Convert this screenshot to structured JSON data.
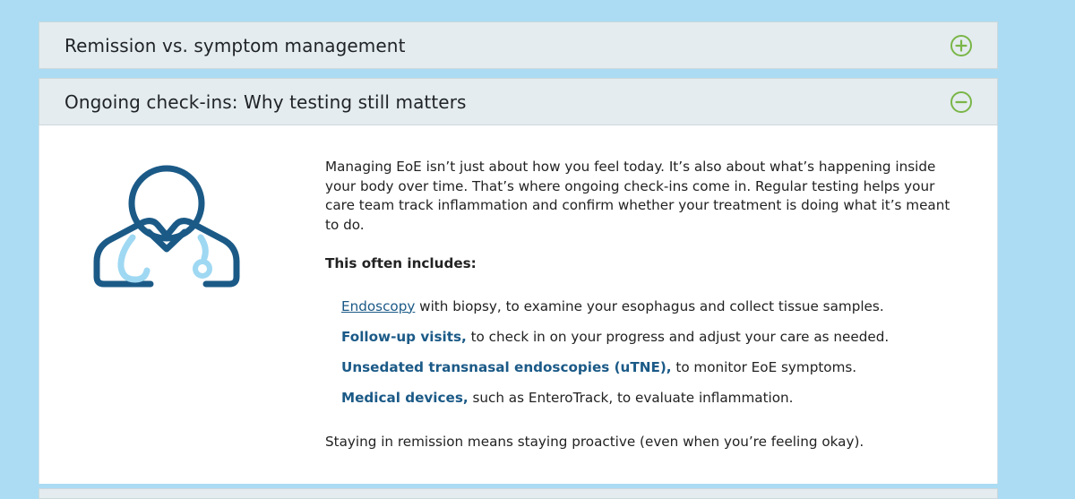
{
  "accordion": {
    "items": [
      {
        "title": "Remission vs. symptom management",
        "state_icon": "plus-circle-icon",
        "expanded": false
      },
      {
        "title": "Ongoing check-ins: Why testing still matters",
        "state_icon": "minus-circle-icon",
        "expanded": true
      }
    ]
  },
  "content": {
    "illustration_icon": "doctor-with-stethoscope-icon",
    "intro": "Managing EoE isn’t just about how you feel today. It’s also about what’s happening inside your body over time. That’s where ongoing check-ins come in. Regular testing helps your care team track inflammation and confirm whether your treatment is doing what it’s meant to do.",
    "includes_heading": "This often includes:",
    "list": [
      {
        "term": "Endoscopy",
        "text": " with biopsy, to examine your esophagus and collect tissue samples.",
        "is_link": true
      },
      {
        "term": "Follow-up visits,",
        "text": " to check in on your progress and adjust your care as needed.",
        "is_link": false
      },
      {
        "term": "Unsedated transnasal endoscopies (uTNE),",
        "text": " to monitor EoE symptoms.",
        "is_link": false
      },
      {
        "term": "Medical devices,",
        "text": " such as EnteroTrack, to evaluate inflammation.",
        "is_link": false
      }
    ],
    "closing": "Staying in remission means staying proactive (even when you’re feeling okay)."
  },
  "colors": {
    "page_background": "#abdcf4",
    "header_background": "#e4ecef",
    "toggle_green": "#7ab648",
    "icon_navy": "#1b5a87",
    "icon_light_blue": "#9fd8f2",
    "term_blue": "#1b5a87"
  }
}
